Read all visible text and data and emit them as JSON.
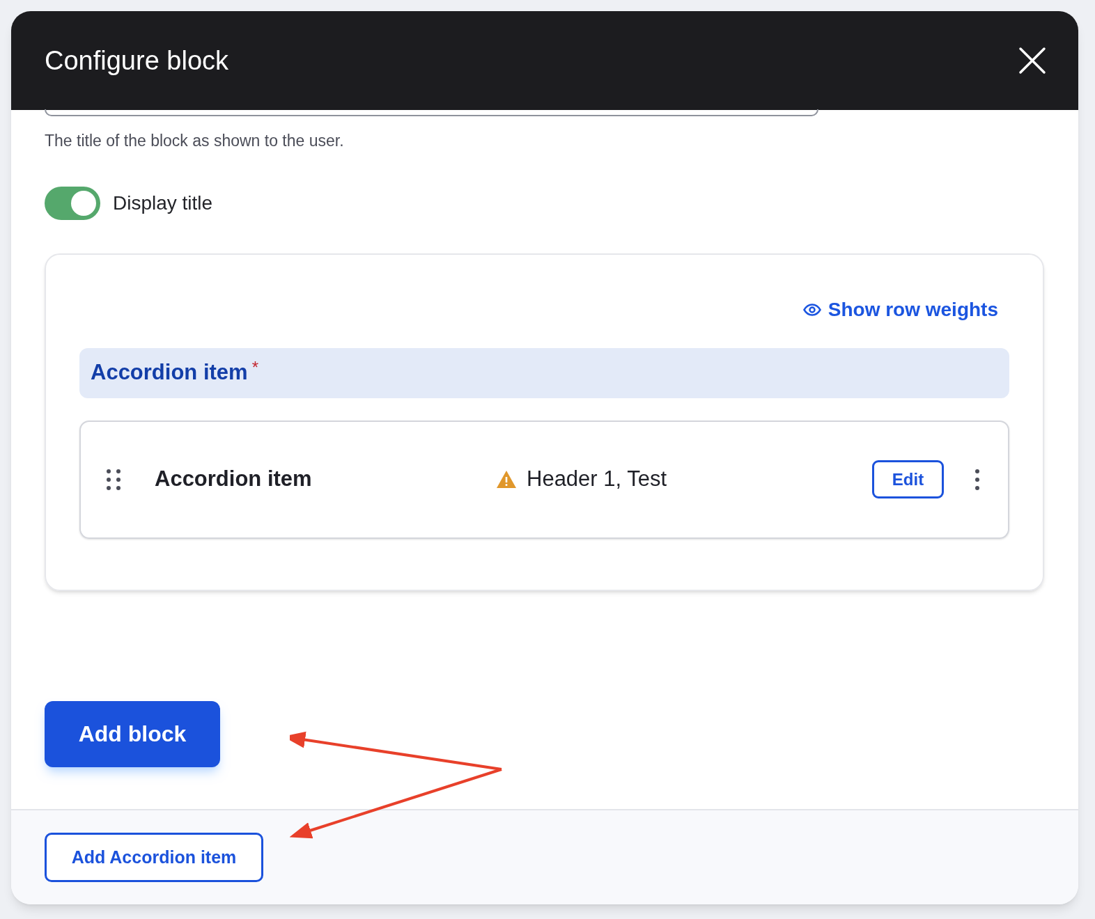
{
  "dialog": {
    "title": "Configure block"
  },
  "title_field": {
    "description": "The title of the block as shown to the user."
  },
  "display_title": {
    "label": "Display title",
    "on": true
  },
  "items_panel": {
    "show_weights_link": "Show row weights",
    "header": {
      "label": "Accordion item",
      "required_mark": "*"
    },
    "rows": [
      {
        "title": "Accordion item",
        "summary": "Header 1, Test",
        "warning": true,
        "edit_label": "Edit"
      }
    ]
  },
  "primary_button": "Add block",
  "footer_button": "Add Accordion item"
}
